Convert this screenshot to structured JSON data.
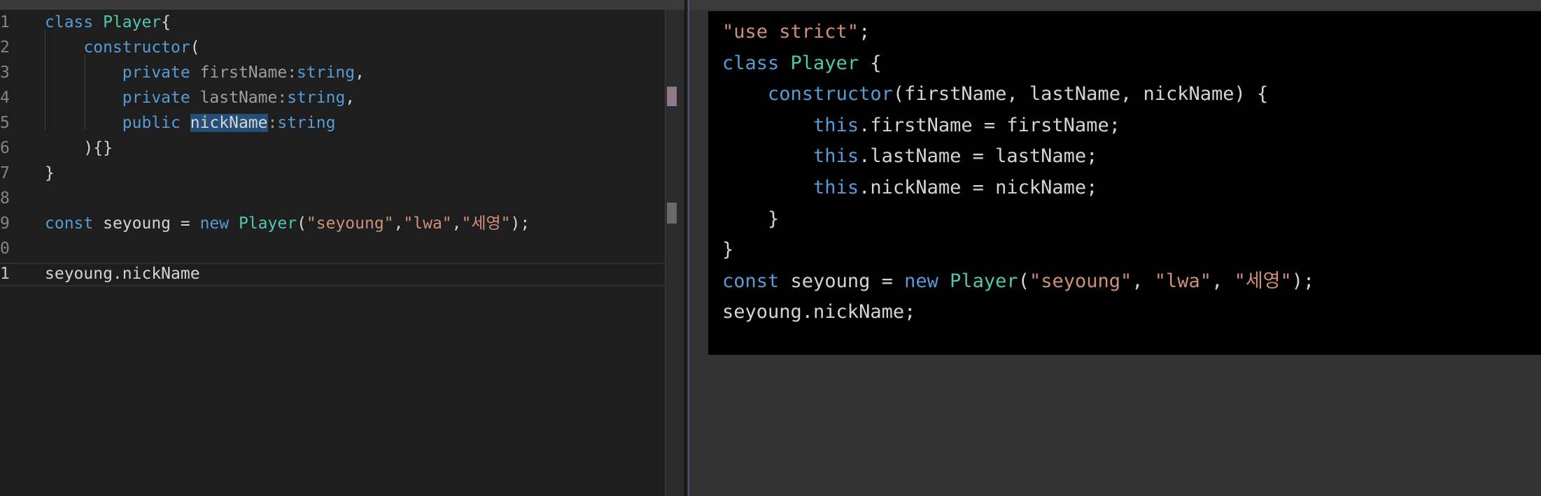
{
  "editor": {
    "line_numbers": [
      "1",
      "2",
      "3",
      "4",
      "5",
      "6",
      "7",
      "8",
      "9",
      "0",
      "1"
    ],
    "lines": [
      [
        {
          "t": "class ",
          "c": "kw"
        },
        {
          "t": "Player",
          "c": "cls"
        },
        {
          "t": "{",
          "c": "plain"
        }
      ],
      [
        {
          "t": "    ",
          "c": "plain"
        },
        {
          "t": "constructor",
          "c": "kw"
        },
        {
          "t": "(",
          "c": "plain"
        }
      ],
      [
        {
          "t": "        ",
          "c": "plain"
        },
        {
          "t": "private ",
          "c": "kw"
        },
        {
          "t": "firstName",
          "c": "dim"
        },
        {
          "t": ":",
          "c": "dim"
        },
        {
          "t": "string",
          "c": "kw"
        },
        {
          "t": ",",
          "c": "plain"
        }
      ],
      [
        {
          "t": "        ",
          "c": "plain"
        },
        {
          "t": "private ",
          "c": "kw"
        },
        {
          "t": "lastName",
          "c": "dim"
        },
        {
          "t": ":",
          "c": "dim"
        },
        {
          "t": "string",
          "c": "kw"
        },
        {
          "t": ",",
          "c": "plain"
        }
      ],
      [
        {
          "t": "        ",
          "c": "plain"
        },
        {
          "t": "public ",
          "c": "kw"
        },
        {
          "t": "nickName",
          "c": "plain",
          "hl": true
        },
        {
          "t": ":",
          "c": "dim"
        },
        {
          "t": "string",
          "c": "kw"
        }
      ],
      [
        {
          "t": "    ",
          "c": "plain"
        },
        {
          "t": "){}",
          "c": "plain"
        }
      ],
      [
        {
          "t": "}",
          "c": "plain"
        }
      ],
      [],
      [
        {
          "t": "const ",
          "c": "kw"
        },
        {
          "t": "seyoung = ",
          "c": "plain"
        },
        {
          "t": "new ",
          "c": "kw"
        },
        {
          "t": "Player",
          "c": "cls"
        },
        {
          "t": "(",
          "c": "plain"
        },
        {
          "t": "\"seyoung\"",
          "c": "str"
        },
        {
          "t": ",",
          "c": "plain"
        },
        {
          "t": "\"lwa\"",
          "c": "str"
        },
        {
          "t": ",",
          "c": "plain"
        },
        {
          "t": "\"세영\"",
          "c": "str"
        },
        {
          "t": ");",
          "c": "plain"
        }
      ],
      [],
      [
        {
          "t": "seyoung.",
          "c": "plain"
        },
        {
          "t": "nickName",
          "c": "plain"
        }
      ]
    ]
  },
  "output": {
    "lines": [
      [
        {
          "t": "\"use strict\"",
          "c": "str"
        },
        {
          "t": ";",
          "c": "plain"
        }
      ],
      [
        {
          "t": "class ",
          "c": "kw"
        },
        {
          "t": "Player",
          "c": "cls"
        },
        {
          "t": " {",
          "c": "plain"
        }
      ],
      [
        {
          "t": "    ",
          "c": "plain"
        },
        {
          "t": "constructor",
          "c": "kw"
        },
        {
          "t": "(firstName, lastName, nickName) {",
          "c": "plain"
        }
      ],
      [
        {
          "t": "        ",
          "c": "plain"
        },
        {
          "t": "this",
          "c": "kw"
        },
        {
          "t": ".firstName = firstName;",
          "c": "plain"
        }
      ],
      [
        {
          "t": "        ",
          "c": "plain"
        },
        {
          "t": "this",
          "c": "kw"
        },
        {
          "t": ".lastName = lastName;",
          "c": "plain"
        }
      ],
      [
        {
          "t": "        ",
          "c": "plain"
        },
        {
          "t": "this",
          "c": "kw"
        },
        {
          "t": ".nickName = nickName;",
          "c": "plain"
        }
      ],
      [
        {
          "t": "    }",
          "c": "plain"
        }
      ],
      [
        {
          "t": "}",
          "c": "plain"
        }
      ],
      [
        {
          "t": "const ",
          "c": "kw"
        },
        {
          "t": "seyoung = ",
          "c": "plain"
        },
        {
          "t": "new ",
          "c": "kw"
        },
        {
          "t": "Player",
          "c": "cls"
        },
        {
          "t": "(",
          "c": "plain"
        },
        {
          "t": "\"seyoung\"",
          "c": "str"
        },
        {
          "t": ", ",
          "c": "plain"
        },
        {
          "t": "\"lwa\"",
          "c": "str"
        },
        {
          "t": ", ",
          "c": "plain"
        },
        {
          "t": "\"세영\"",
          "c": "str"
        },
        {
          "t": ");",
          "c": "plain"
        }
      ],
      [
        {
          "t": "seyoung.nickName;",
          "c": "plain"
        }
      ]
    ]
  },
  "colors": {
    "editor_bg": "#1e1e1e",
    "output_bg": "#000000",
    "keyword": "#569cd6",
    "class": "#4ec9b0",
    "string": "#ce9178",
    "selection": "#264f78"
  }
}
